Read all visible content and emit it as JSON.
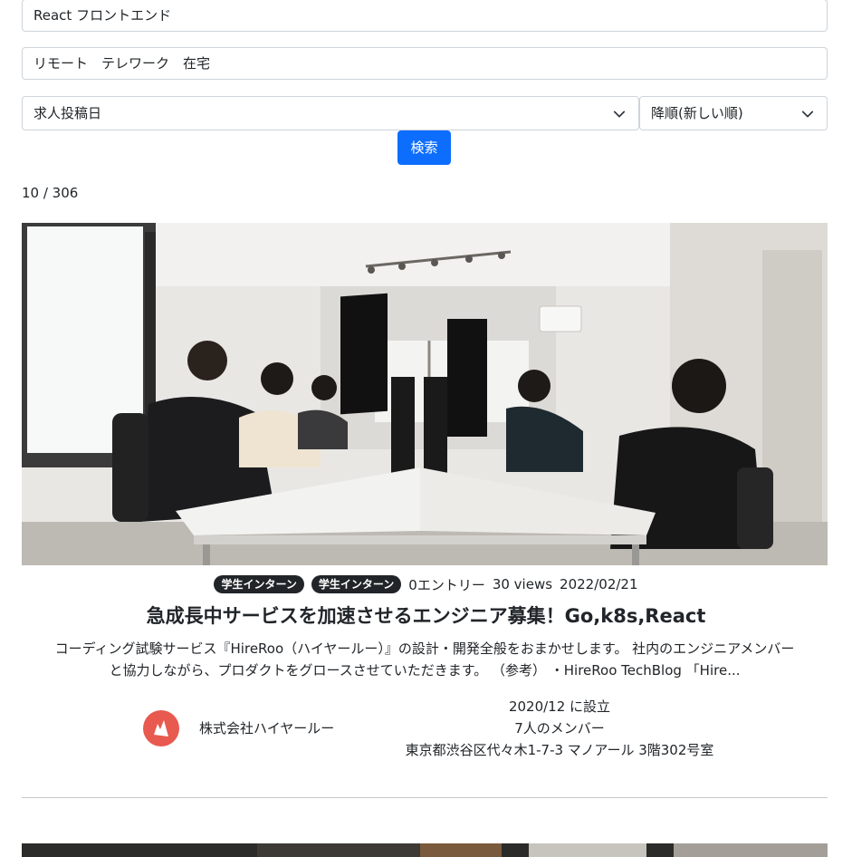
{
  "search": {
    "keyword_value": "React フロントエンド",
    "location_value": "リモート　テレワーク　在宅",
    "sort_field": "求人投稿日",
    "sort_order": "降順(新しい順)",
    "submit_label": "検索"
  },
  "results": {
    "count_text": "10 / 306"
  },
  "job": {
    "tags": [
      "学生インターン",
      "学生インターン"
    ],
    "entries": "0エントリー",
    "views": "30 views",
    "date": "2022/02/21",
    "title": "急成長中サービスを加速させるエンジニア募集！Go,k8s,React",
    "description_line1": "コーディング試験サービス『HireRoo（ハイヤールー）』の設計・開発全般をおまかせします。 社内のエンジニアメンバー",
    "description_line2": "と協力しながら、プロダクトをグロースさせていただきます。 （参考） ・HireRoo TechBlog 「Hire...",
    "company_name": "株式会社ハイヤールー",
    "founded": "2020/12 に設立",
    "members": "7人のメンバー",
    "address": "東京都渋谷区代々木1-7-3 マノアール 3階302号室"
  },
  "icons": {
    "select_arrow": "chevron-down-icon",
    "company_logo": "company-logo"
  },
  "colors": {
    "primary": "#0d6efd",
    "badge": "#212529",
    "logo": "#e8594f"
  }
}
